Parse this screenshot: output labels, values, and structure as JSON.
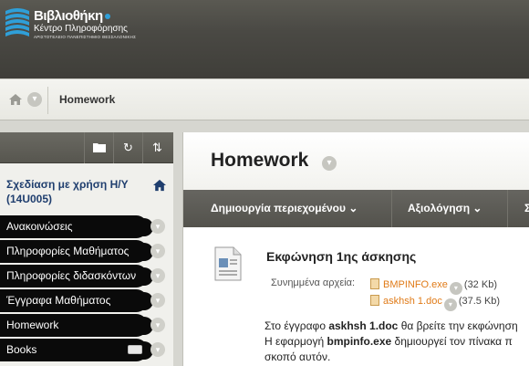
{
  "header": {
    "logo_title": "Βιβλιοθήκη",
    "logo_subtitle": "Κέντρο Πληροφόρησης",
    "logo_tagline": "ΑΡΙΣΤΟΤΕΛΕΙΟ ΠΑΝΕΠΙΣΤΗΜΙΟ ΘΕΣΣΑΛΟΝΙΚΗΣ"
  },
  "breadcrumb": {
    "home_icon": "home-icon",
    "current": "Homework"
  },
  "course_menu": {
    "toolbar_icons": [
      "folder-icon",
      "refresh-icon",
      "sort-icon"
    ],
    "course_title": "Σχεδίαση με χρήση Η/Υ (14U005)",
    "items": [
      {
        "label": "Ανακοινώσεις"
      },
      {
        "label": "Πληροφορίες Μαθήματος"
      },
      {
        "label": "Πληροφορίες διδασκόντων"
      },
      {
        "label": "Έγγραφα Μαθήματος"
      },
      {
        "label": "Homework"
      },
      {
        "label": "Books"
      }
    ]
  },
  "content": {
    "title": "Homework",
    "actions": [
      {
        "label": "Δημιουργία περιεχομένου"
      },
      {
        "label": "Αξιολόγηση"
      },
      {
        "label": "Σ"
      }
    ],
    "item": {
      "title": "Εκφώνηση 1ης άσκησης",
      "attachments_label": "Συνημμένα αρχεία:",
      "attachments": [
        {
          "name": "BMPINFO.exe",
          "size": "(32 Kb)"
        },
        {
          "name": "askhsh 1.doc",
          "size": "(37.5 Kb)"
        }
      ],
      "description": {
        "line1_pre": "Στο έγγραφο ",
        "line1_bold": "askhsh 1.doc",
        "line1_post": " θα βρείτε την εκφώνηση",
        "line2_pre": "Η εφαρμογή ",
        "line2_bold": "bmpinfo.exe",
        "line2_post": " δημιουργεί τον πίνακα π",
        "line3": "σκοπό αυτόν."
      }
    }
  }
}
